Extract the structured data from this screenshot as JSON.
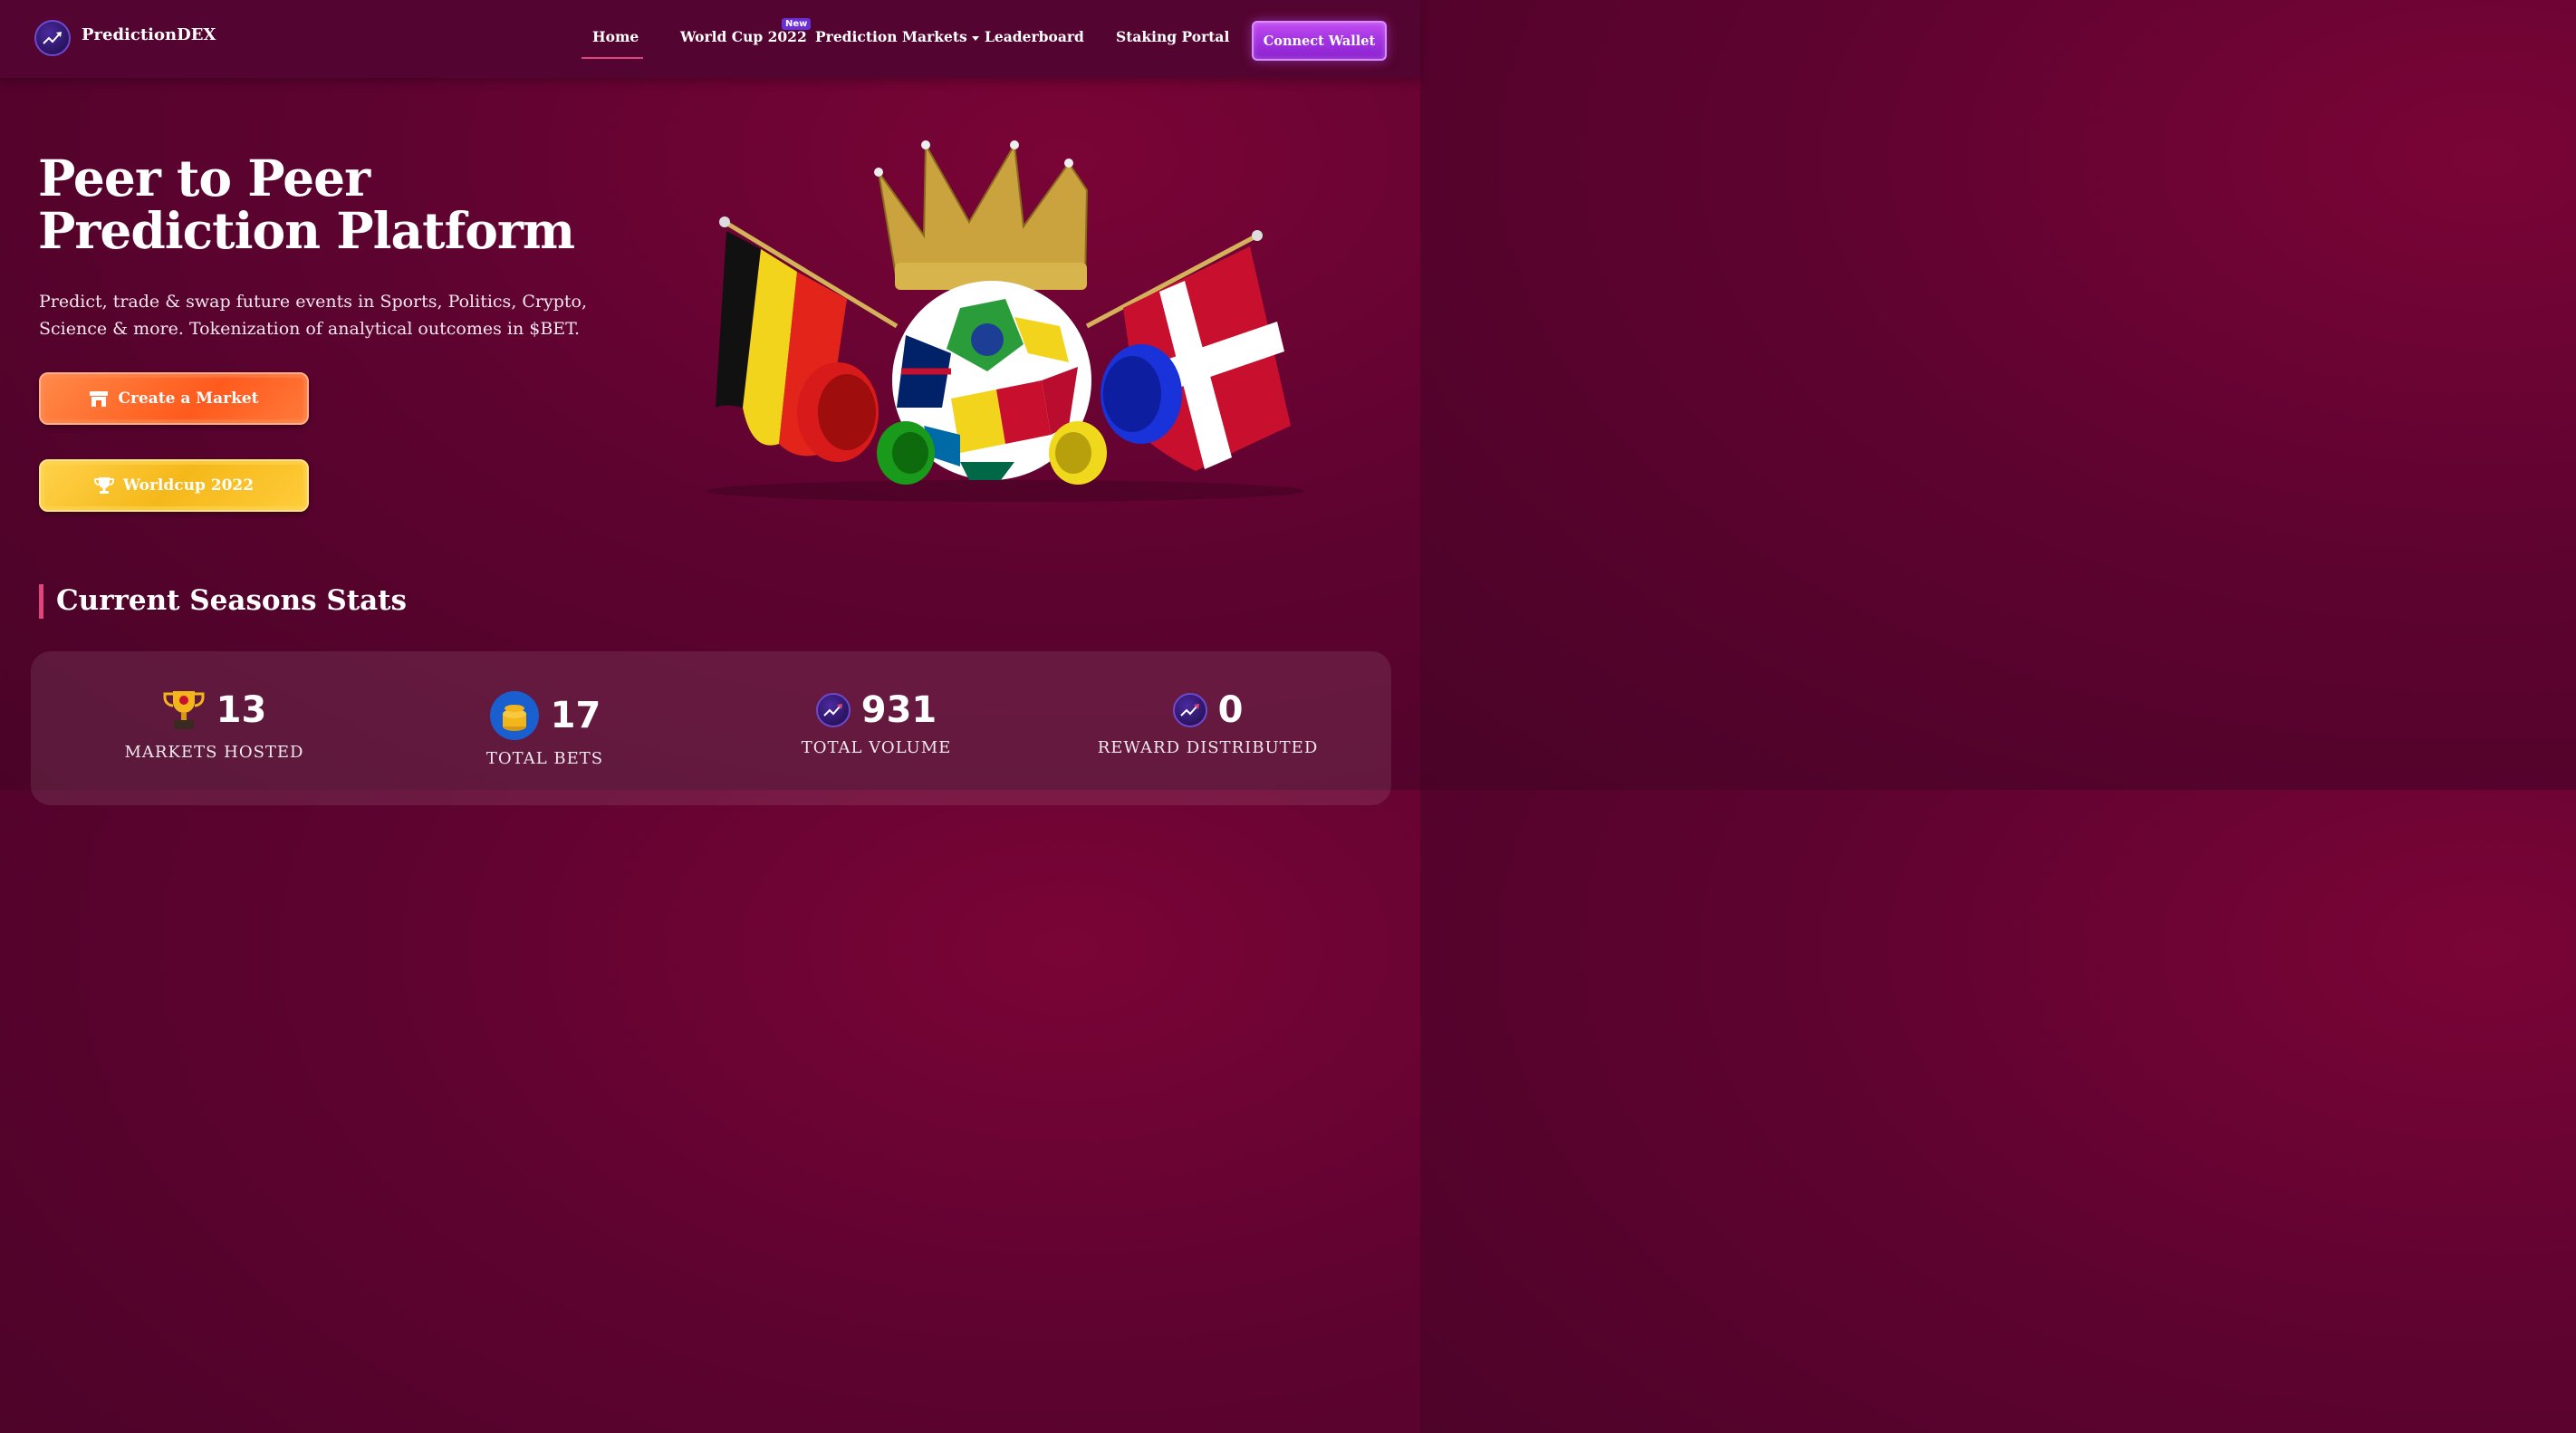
{
  "brand": {
    "name": "PredictionDEX",
    "logo_icon": "trend-arrow-icon"
  },
  "nav": {
    "home": "Home",
    "world_cup": "World Cup 2022",
    "new_badge": "New",
    "prediction_markets": "Prediction Markets",
    "leaderboard": "Leaderboard",
    "staking": "Staking Portal",
    "connect_wallet": "Connect Wallet"
  },
  "hero": {
    "title_line1": "Peer to Peer",
    "title_line2": "Prediction Platform",
    "description": "Predict, trade & swap future events in Sports, Politics, Crypto, Science & more. Tokenization of analytical outcomes in $BET.",
    "create_market": "Create a Market",
    "create_market_icon": "store-icon",
    "worldcup": "Worldcup 2022",
    "worldcup_icon": "trophy-icon"
  },
  "stats": {
    "section_title": "Current Seasons Stats",
    "items": [
      {
        "value": "13",
        "label": "MARKETS HOSTED",
        "icon": "trophy-icon"
      },
      {
        "value": "17",
        "label": "TOTAL BETS",
        "icon": "coins-icon"
      },
      {
        "value": "931",
        "label": "TOTAL VOLUME",
        "icon": "trend-arrow-icon"
      },
      {
        "value": "0",
        "label": "REWARD DISTRIBUTED",
        "icon": "trend-arrow-icon"
      }
    ]
  },
  "colors": {
    "background": "#5e0330",
    "header": "#540430",
    "accent_pink": "#e0457b",
    "connect_purple": "#a233e0",
    "orange_button": "#ff6a2a",
    "yellow_button": "#f5b81a"
  }
}
